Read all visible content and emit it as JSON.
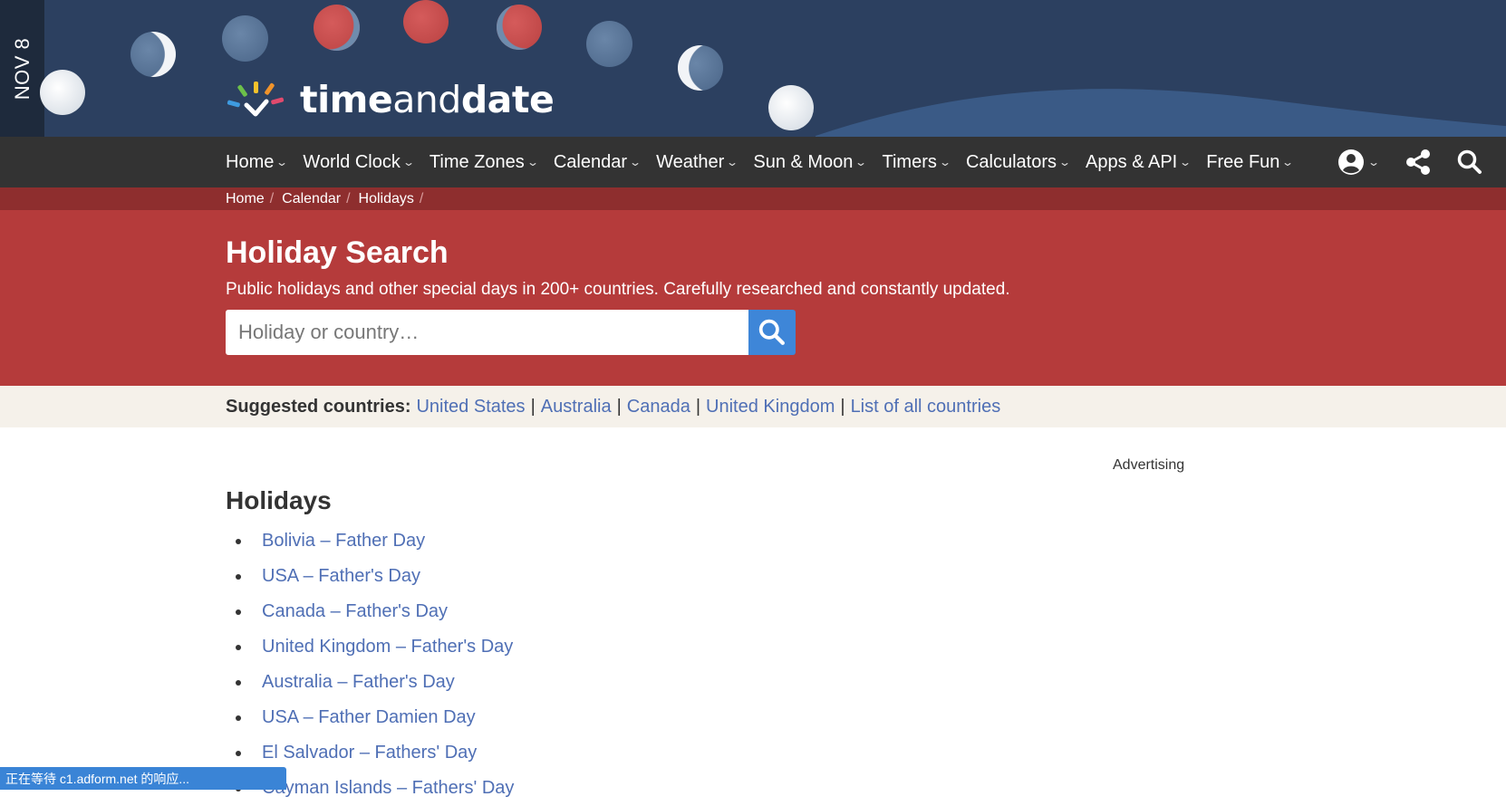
{
  "banner": {
    "date_label": "NOV 8",
    "logo_text_bold1": "time",
    "logo_text_regular": "and",
    "logo_text_bold2": "date"
  },
  "nav": {
    "items": [
      {
        "label": "Home"
      },
      {
        "label": "World Clock"
      },
      {
        "label": "Time Zones"
      },
      {
        "label": "Calendar"
      },
      {
        "label": "Weather"
      },
      {
        "label": "Sun & Moon"
      },
      {
        "label": "Timers"
      },
      {
        "label": "Calculators"
      },
      {
        "label": "Apps & API"
      },
      {
        "label": "Free Fun"
      }
    ],
    "icons": [
      "account-icon",
      "share-icon",
      "search-icon"
    ]
  },
  "breadcrumb": {
    "items": [
      {
        "label": "Home"
      },
      {
        "label": "Calendar"
      },
      {
        "label": "Holidays"
      }
    ]
  },
  "hero": {
    "title": "Holiday Search",
    "subtitle": "Public holidays and other special days in 200+ countries. Carefully researched and constantly updated.",
    "search_placeholder": "Holiday or country…",
    "search_value": "",
    "search_button_icon": "search-icon"
  },
  "suggested": {
    "label": "Suggested countries:",
    "countries": [
      {
        "label": "United States"
      },
      {
        "label": "Australia"
      },
      {
        "label": "Canada"
      },
      {
        "label": "United Kingdom"
      },
      {
        "label": "List of all countries"
      }
    ]
  },
  "content": {
    "advertising_label": "Advertising",
    "holidays_title": "Holidays",
    "holidays": [
      {
        "label": "Bolivia – Father Day"
      },
      {
        "label": "USA – Father's Day"
      },
      {
        "label": "Canada – Father's Day"
      },
      {
        "label": "United Kingdom – Father's Day"
      },
      {
        "label": "Australia – Father's Day"
      },
      {
        "label": "USA – Father Damien Day"
      },
      {
        "label": "El Salvador – Fathers' Day"
      },
      {
        "label": "Cayman Islands – Fathers' Day"
      }
    ]
  },
  "statusbar": {
    "text": "正在等待 c1.adform.net 的响应..."
  },
  "colors": {
    "banner_bg": "#2c4060",
    "nav_bg": "#333333",
    "breadcrumb_bg": "#8e2e2e",
    "hero_bg": "#b53b3b",
    "search_button": "#3e86d8",
    "link": "#4f6fb5",
    "suggest_bg": "#f5f1ea"
  }
}
